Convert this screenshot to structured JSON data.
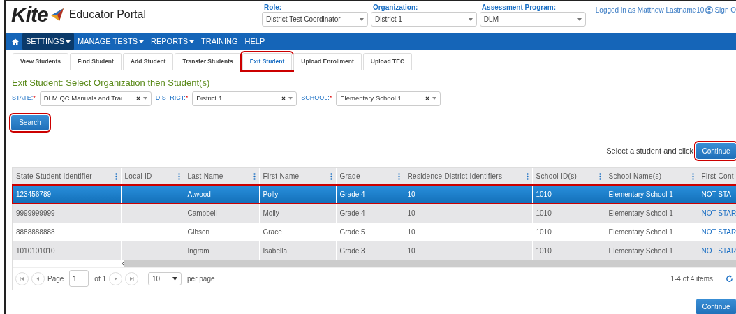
{
  "header": {
    "logo_text": "Kite",
    "portal_title": "Educator Portal",
    "selectors": [
      {
        "label": "Role:",
        "value": "District Test Coordinator"
      },
      {
        "label": "Organization:",
        "value": "District 1"
      },
      {
        "label": "Assessment Program:",
        "value": "DLM"
      }
    ],
    "user_text": "Logged in as Matthew Lastname10",
    "sign_out": "Sign O"
  },
  "nav": [
    {
      "label": "SETTINGS",
      "dropdown": true,
      "selected": true
    },
    {
      "label": "MANAGE TESTS",
      "dropdown": true,
      "selected": false
    },
    {
      "label": "REPORTS",
      "dropdown": true,
      "selected": false
    },
    {
      "label": "TRAINING",
      "dropdown": false,
      "selected": false
    },
    {
      "label": "HELP",
      "dropdown": false,
      "selected": false
    }
  ],
  "tabs": [
    {
      "label": "View Students",
      "selected": false,
      "highlighted": false
    },
    {
      "label": "Find Student",
      "selected": false,
      "highlighted": false
    },
    {
      "label": "Add Student",
      "selected": false,
      "highlighted": false
    },
    {
      "label": "Transfer Students",
      "selected": false,
      "highlighted": false
    },
    {
      "label": "Exit Student",
      "selected": true,
      "highlighted": true
    },
    {
      "label": "Upload Enrollment",
      "selected": false,
      "highlighted": false
    },
    {
      "label": "Upload TEC",
      "selected": false,
      "highlighted": false
    }
  ],
  "heading": "Exit Student: Select Organization then Student(s)",
  "filters": [
    {
      "label": "STATE:",
      "required_mark": "*",
      "value": "DLM QC Manuals and Trai…"
    },
    {
      "label": "DISTRICT:",
      "required_mark": "*",
      "value": "District 1"
    },
    {
      "label": "SCHOOL:",
      "required_mark": "*",
      "value": "Elementary School 1"
    }
  ],
  "search_button": {
    "label": "Search",
    "highlighted": true
  },
  "instruction": "Select a student and click",
  "continue_top": {
    "label": "Continue",
    "highlighted": true
  },
  "table": {
    "columns": [
      "State Student Identifier",
      "Local ID",
      "Last Name",
      "First Name",
      "Grade",
      "Residence District Identifiers",
      "School ID(s)",
      "School Name(s)",
      "First Cont"
    ],
    "rows": [
      {
        "selected": true,
        "highlighted": true,
        "cells": [
          "123456789",
          "",
          "Atwood",
          "Polly",
          "Grade 4",
          "10",
          "1010",
          "Elementary School 1",
          "NOT STA"
        ]
      },
      {
        "selected": false,
        "highlighted": false,
        "cells": [
          "9999999999",
          "",
          "Campbell",
          "Molly",
          "Grade 4",
          "10",
          "1010",
          "Elementary School 1",
          "NOT STAR"
        ]
      },
      {
        "selected": false,
        "highlighted": false,
        "cells": [
          "8888888888",
          "",
          "Gibson",
          "Grace",
          "Grade 5",
          "10",
          "1010",
          "Elementary School 1",
          "NOT STAR"
        ]
      },
      {
        "selected": false,
        "highlighted": false,
        "cells": [
          "1010101010",
          "",
          "Ingram",
          "Isabella",
          "Grade 3",
          "10",
          "1010",
          "Elementary School 1",
          "NOT STAR"
        ]
      }
    ]
  },
  "pager": {
    "page_label": "Page",
    "page": "1",
    "of_label": "of 1",
    "page_size": "10",
    "per_page_label": "per page",
    "items_label": "1-4 of 4 items"
  },
  "continue_bottom": {
    "label": "Continue"
  }
}
